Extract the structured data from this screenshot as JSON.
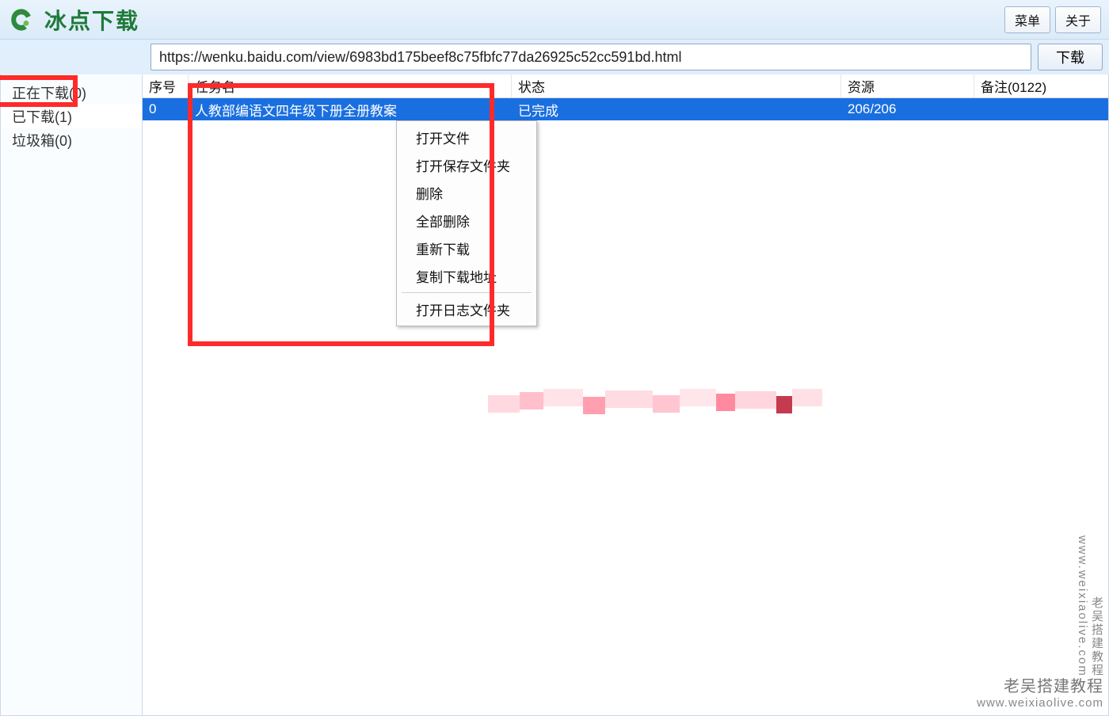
{
  "app": {
    "title": "冰点下载"
  },
  "topbuttons": {
    "menu": "菜单",
    "about": "关于"
  },
  "url": {
    "value": "https://wenku.baidu.com/view/6983bd175beef8c75fbfc77da26925c52cc591bd.html",
    "download": "下载"
  },
  "sidebar": {
    "items": [
      {
        "label": "正在下载(0)"
      },
      {
        "label": "已下载(1)"
      },
      {
        "label": "垃圾箱(0)"
      }
    ],
    "selected_index": 1
  },
  "columns": {
    "idx": "序号",
    "name": "任务名",
    "state": "状态",
    "res": "资源",
    "note": "备注(0122)"
  },
  "rows": [
    {
      "idx": "0",
      "name": "人教部编语文四年级下册全册教案",
      "state": "已完成",
      "res": "206/206",
      "note": ""
    }
  ],
  "context_menu": {
    "items": [
      "打开文件",
      "打开保存文件夹",
      "删除",
      "全部删除",
      "重新下载",
      "复制下载地址"
    ],
    "items2": [
      "打开日志文件夹"
    ]
  },
  "watermark": {
    "line1": "老吴搭建教程",
    "line2": "www.weixiaolive.com",
    "vline": "老吴搭建教程  www.weixiaolive.com"
  }
}
